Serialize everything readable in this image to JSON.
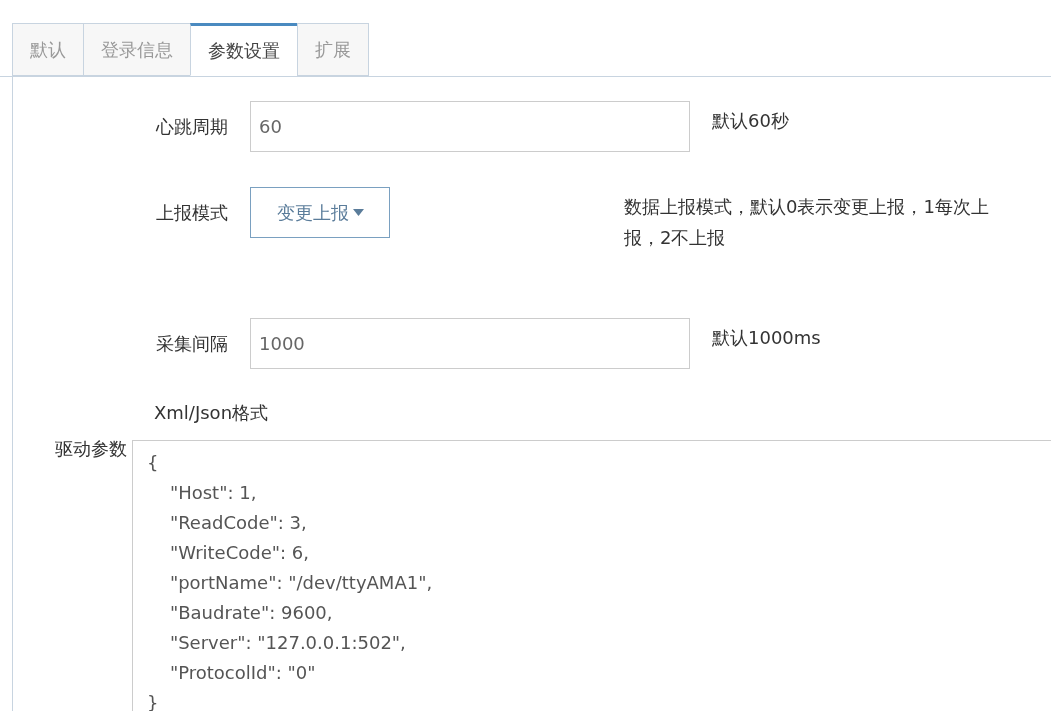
{
  "tabs": [
    {
      "label": "默认",
      "selected": false
    },
    {
      "label": "登录信息",
      "selected": false
    },
    {
      "label": "参数设置",
      "selected": true
    },
    {
      "label": "扩展",
      "selected": false
    }
  ],
  "fields": [
    {
      "kind": "input",
      "label": "心跳周期",
      "value": "60",
      "help": "默认60秒"
    },
    {
      "kind": "select",
      "label": "上报模式",
      "value": "变更上报",
      "help": "数据上报模式，默认0表示变更上报，1每次上报，2不上报"
    },
    {
      "kind": "input",
      "label": "采集间隔",
      "value": "1000",
      "help": "默认1000ms"
    }
  ],
  "driver_params": {
    "label": "驱动参数",
    "hint": "Xml/Json格式",
    "value": "{\n    \"Host\": 1,\n    \"ReadCode\": 3,\n    \"WriteCode\": 6,\n    \"portName\": \"/dev/ttyAMA1\",\n    \"Baudrate\": 9600,\n    \"Server\": \"127.0.0.1:502\",\n    \"ProtocolId\": \"0\"\n}"
  }
}
